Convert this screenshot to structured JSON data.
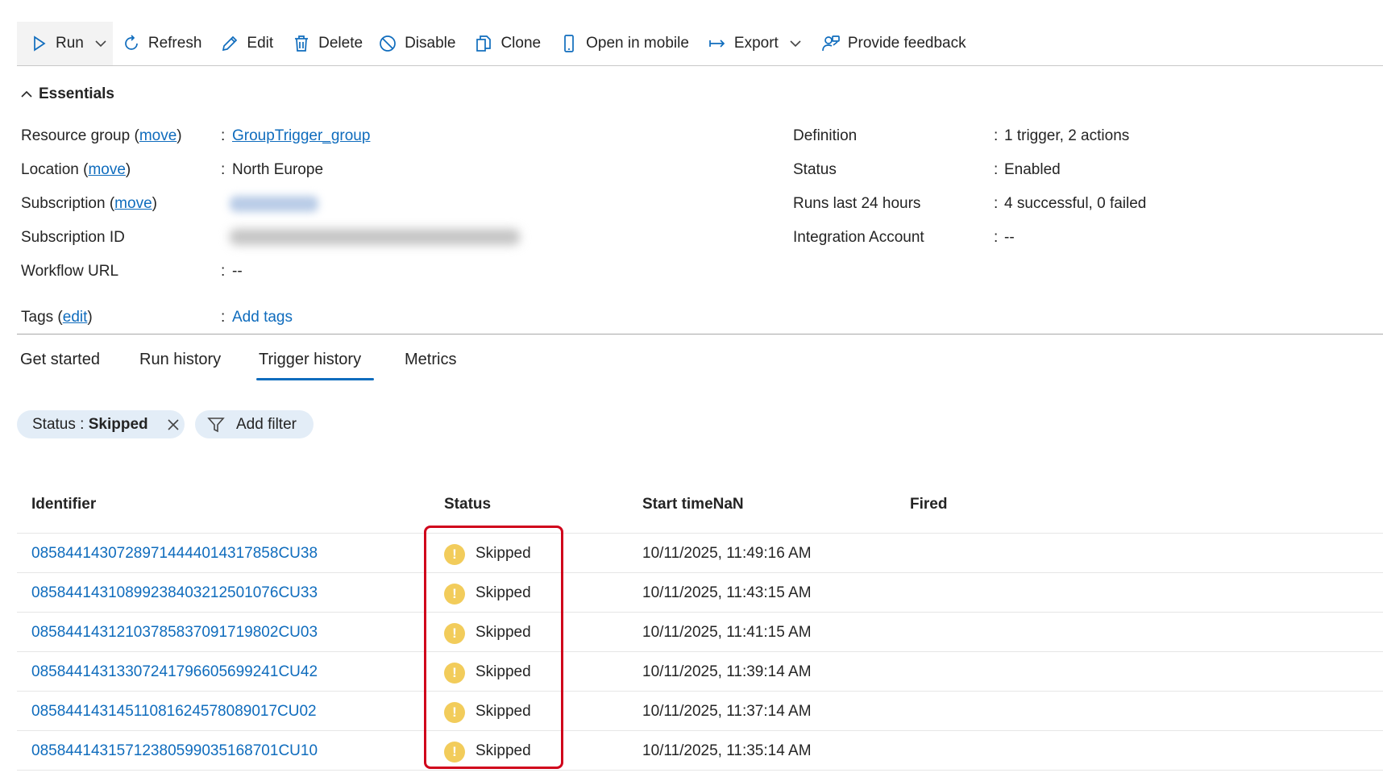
{
  "toolbar": {
    "run": "Run",
    "refresh": "Refresh",
    "edit": "Edit",
    "delete": "Delete",
    "disable": "Disable",
    "clone": "Clone",
    "open_mobile": "Open in mobile",
    "export": "Export",
    "feedback": "Provide feedback"
  },
  "essentials": {
    "title": "Essentials",
    "left": {
      "resource_group_label": "Resource group",
      "resource_group_value": "GroupTrigger_group",
      "location_label": "Location",
      "location_value": "North Europe",
      "subscription_label": "Subscription",
      "subscription_id_label": "Subscription ID",
      "workflow_url_label": "Workflow URL",
      "workflow_url_value": "--",
      "tags_label": "Tags",
      "tags_edit": "edit",
      "tags_value": "Add tags",
      "move": "move"
    },
    "right": {
      "definition_label": "Definition",
      "definition_value": "1 trigger, 2 actions",
      "status_label": "Status",
      "status_value": "Enabled",
      "runs_label": "Runs last 24 hours",
      "runs_value": "4 successful, 0 failed",
      "integration_label": "Integration Account",
      "integration_value": "--"
    }
  },
  "tabs": [
    {
      "label": "Get started"
    },
    {
      "label": "Run history"
    },
    {
      "label": "Trigger history"
    },
    {
      "label": "Metrics"
    }
  ],
  "filters": {
    "status_key": "Status",
    "status_value": "Skipped",
    "add_filter": "Add filter"
  },
  "table": {
    "headers": [
      "Identifier",
      "Status",
      "Start timeNaN",
      "Fired"
    ],
    "rows": [
      {
        "id": "08584414307289714444014317858CU38",
        "status": "Skipped",
        "start": "10/11/2025, 11:49:16 AM"
      },
      {
        "id": "08584414310899238403212501076CU33",
        "status": "Skipped",
        "start": "10/11/2025, 11:43:15 AM"
      },
      {
        "id": "08584414312103785837091719802CU03",
        "status": "Skipped",
        "start": "10/11/2025, 11:41:15 AM"
      },
      {
        "id": "08584414313307241796605699241CU42",
        "status": "Skipped",
        "start": "10/11/2025, 11:39:14 AM"
      },
      {
        "id": "08584414314511081624578089017CU02",
        "status": "Skipped",
        "start": "10/11/2025, 11:37:14 AM"
      },
      {
        "id": "08584414315712380599035168701CU10",
        "status": "Skipped",
        "start": "10/11/2025, 11:35:14 AM"
      }
    ]
  },
  "colors": {
    "accent": "#0f6cbd",
    "warning": "#f2cc5b",
    "highlight": "#d0021b",
    "pill_bg": "#e3edf7"
  }
}
